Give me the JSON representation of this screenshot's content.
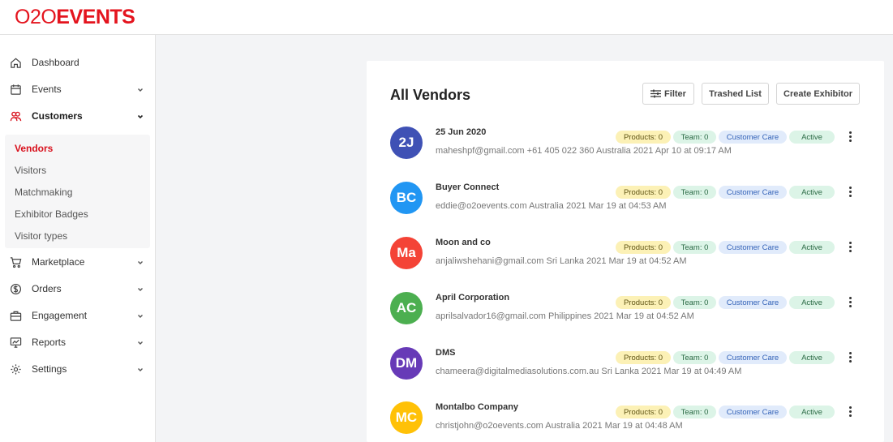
{
  "brand": {
    "logo_part1": "O2O",
    "logo_part2": "EVENTS",
    "color": "#e4141e"
  },
  "sidebar": {
    "items": [
      {
        "label": "Dashboard",
        "icon": "home-icon"
      },
      {
        "label": "Events",
        "icon": "calendar-icon"
      },
      {
        "label": "Customers",
        "icon": "users-icon",
        "active": true
      },
      {
        "label": "Marketplace",
        "icon": "cart-icon"
      },
      {
        "label": "Orders",
        "icon": "currency-icon"
      },
      {
        "label": "Engagement",
        "icon": "briefcase-icon"
      },
      {
        "label": "Reports",
        "icon": "chart-icon"
      },
      {
        "label": "Settings",
        "icon": "gear-icon"
      }
    ],
    "customers_sub": [
      {
        "label": "Vendors",
        "active": true
      },
      {
        "label": "Visitors"
      },
      {
        "label": "Matchmaking"
      },
      {
        "label": "Exhibitor Badges"
      },
      {
        "label": "Visitor types"
      }
    ]
  },
  "main": {
    "title": "All Vendors",
    "buttons": {
      "filter": "Filter",
      "trashed": "Trashed List",
      "create": "Create Exhibitor"
    },
    "vendors": [
      {
        "initials": "2J",
        "color": "#3f51b5",
        "name": "25 Jun 2020",
        "info": "maheshpf@gmail.com +61 405 022 360 Australia 2021 Apr 10 at 09:17 AM",
        "products": "Products: 0",
        "team": "Team: 0",
        "care": "Customer Care",
        "status": "Active"
      },
      {
        "initials": "BC",
        "color": "#2196f3",
        "name": "Buyer Connect",
        "info": "eddie@o2oevents.com Australia 2021 Mar 19 at 04:53 AM",
        "products": "Products: 0",
        "team": "Team: 0",
        "care": "Customer Care",
        "status": "Active"
      },
      {
        "initials": "Ma",
        "color": "#f44336",
        "name": "Moon and co",
        "info": "anjaliwshehani@gmail.com Sri Lanka 2021 Mar 19 at 04:52 AM",
        "products": "Products: 0",
        "team": "Team: 0",
        "care": "Customer Care",
        "status": "Active"
      },
      {
        "initials": "AC",
        "color": "#4caf50",
        "name": "April Corporation",
        "info": "aprilsalvador16@gmail.com Philippines 2021 Mar 19 at 04:52 AM",
        "products": "Products: 0",
        "team": "Team: 0",
        "care": "Customer Care",
        "status": "Active"
      },
      {
        "initials": "DM",
        "color": "#673ab7",
        "name": "DMS",
        "info": "chameera@digitalmediasolutions.com.au Sri Lanka 2021 Mar 19 at 04:49 AM",
        "products": "Products: 0",
        "team": "Team: 0",
        "care": "Customer Care",
        "status": "Active"
      },
      {
        "initials": "MC",
        "color": "#ffc107",
        "name": "Montalbo Company",
        "info": "christjohn@o2oevents.com Australia 2021 Mar 19 at 04:48 AM",
        "products": "Products: 0",
        "team": "Team: 0",
        "care": "Customer Care",
        "status": "Active"
      }
    ]
  }
}
